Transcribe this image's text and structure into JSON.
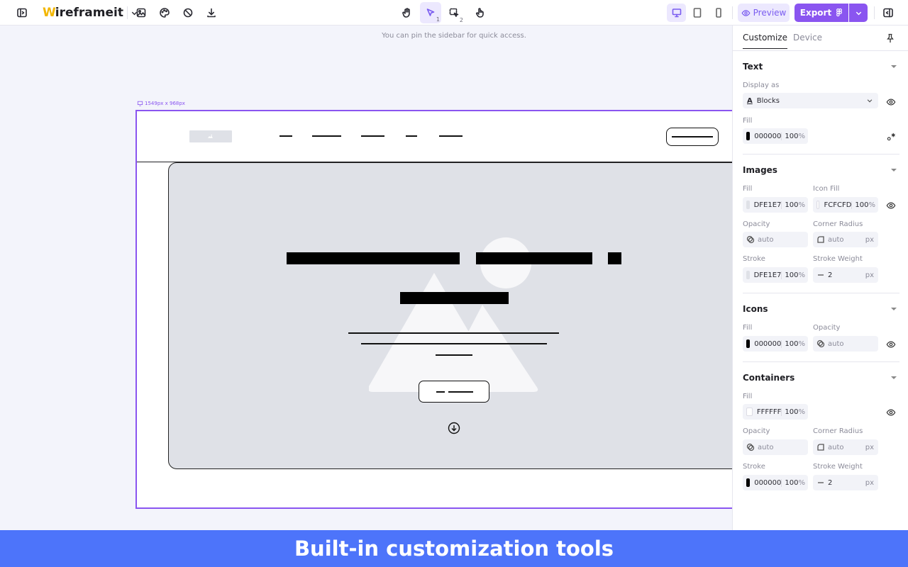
{
  "app": {
    "logo_mark": "W",
    "logo_text": "ireframeit"
  },
  "toolbar": {
    "select_sub": "1",
    "multi_select_sub": "2",
    "preview_label": "Preview",
    "export_label": "Export"
  },
  "canvas": {
    "hint": "You can pin the sidebar for quick access.",
    "size_label": "1549px x 968px"
  },
  "sidebar": {
    "tabs": [
      "Customize",
      "Device"
    ],
    "text": {
      "title": "Text",
      "display_as_label": "Display as",
      "display_as_value": "Blocks",
      "fill_label": "Fill",
      "fill_hex": "000000",
      "fill_pct": "100",
      "pct_sign": "%"
    },
    "images": {
      "title": "Images",
      "fill_label": "Fill",
      "fill_hex": "DFE1E7",
      "fill_pct": "100",
      "icon_fill_label": "Icon Fill",
      "icon_fill_hex": "FCFCFD",
      "icon_fill_pct": "100",
      "opacity_label": "Opacity",
      "opacity_value": "auto",
      "corner_radius_label": "Corner Radius",
      "corner_radius_value": "auto",
      "stroke_label": "Stroke",
      "stroke_hex": "DFE1E7",
      "stroke_pct": "100",
      "stroke_weight_label": "Stroke Weight",
      "stroke_weight_value": "2",
      "unit": "px"
    },
    "icons": {
      "title": "Icons",
      "fill_label": "Fill",
      "fill_hex": "000000",
      "fill_pct": "100",
      "opacity_label": "Opacity",
      "opacity_value": "auto"
    },
    "containers": {
      "title": "Containers",
      "fill_label": "Fill",
      "fill_hex": "FFFFFF",
      "fill_pct": "100",
      "opacity_label": "Opacity",
      "opacity_value": "auto",
      "corner_radius_label": "Corner Radius",
      "corner_radius_value": "auto",
      "stroke_label": "Stroke",
      "stroke_hex": "000000",
      "stroke_pct": "100",
      "stroke_weight_label": "Stroke Weight",
      "stroke_weight_value": "2",
      "unit": "px"
    }
  },
  "banner": {
    "text": "Built-in customization tools"
  },
  "colors": {
    "accent": "#8a55f0",
    "banner": "#4d74fa",
    "swatch_black": "#000000",
    "swatch_grey": "#dfe1e7",
    "swatch_icon": "#fcfcfd",
    "swatch_white": "#ffffff"
  }
}
